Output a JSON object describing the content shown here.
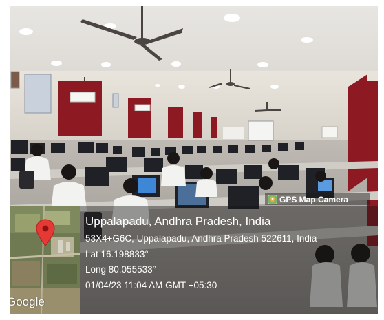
{
  "camera_badge": {
    "label": "GPS Map Camera",
    "icon": "map-pin-icon"
  },
  "map": {
    "provider_label": "Google",
    "pin_color": "#e53935"
  },
  "location": {
    "title": "Uppalapadu, Andhra Pradesh, India",
    "address": "53X4+G6C, Uppalapadu, Andhra Pradesh 522611, India",
    "latitude": "Lat 16.198833°",
    "longitude": "Long 80.055533°",
    "timestamp": "01/04/23 11:04 AM GMT +05:30"
  }
}
